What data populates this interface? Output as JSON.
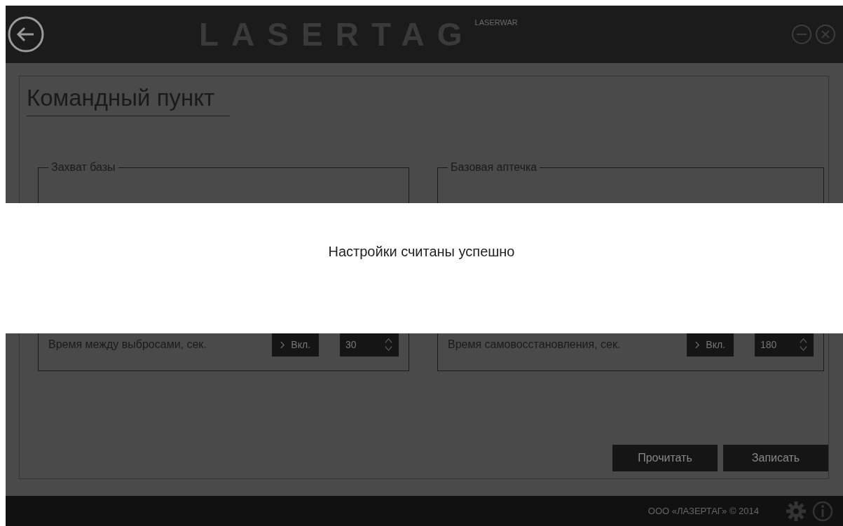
{
  "header": {
    "logo": "LASERTAG",
    "brand": "LASERWAR"
  },
  "page": {
    "title": "Командный пункт"
  },
  "groups": [
    {
      "title": "Захват базы",
      "rows": [
        {
          "label": "Время между выбросами, сек.",
          "toggle": "Вкл.",
          "value": "30"
        }
      ]
    },
    {
      "title": "Базовая аптечка",
      "rows": [
        {
          "label": "Время самовосстановления, сек.",
          "toggle": "Вкл.",
          "value": "180"
        }
      ]
    }
  ],
  "actions": [
    "Прочитать",
    "Записать"
  ],
  "footer": {
    "copyright": "ООО «ЛАЗЕРТАГ» © 2014"
  },
  "notification": {
    "message": "Настройки считаны успешно"
  }
}
